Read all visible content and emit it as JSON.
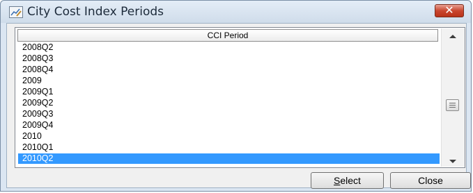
{
  "window": {
    "title": "City Cost Index Periods",
    "close_glyph": "✕",
    "icon": "chart-pencil-icon"
  },
  "grid": {
    "column_header": "CCI Period",
    "rows": [
      "2008Q2",
      "2008Q3",
      "2008Q4",
      "2009",
      "2009Q1",
      "2009Q2",
      "2009Q3",
      "2009Q4",
      "2010",
      "2010Q1",
      "2010Q2"
    ],
    "selected_row": "2010Q2",
    "selection_color": "#3399ff"
  },
  "buttons": {
    "select_mnemonic": "S",
    "select_rest": "elect",
    "close_label": "Close"
  }
}
